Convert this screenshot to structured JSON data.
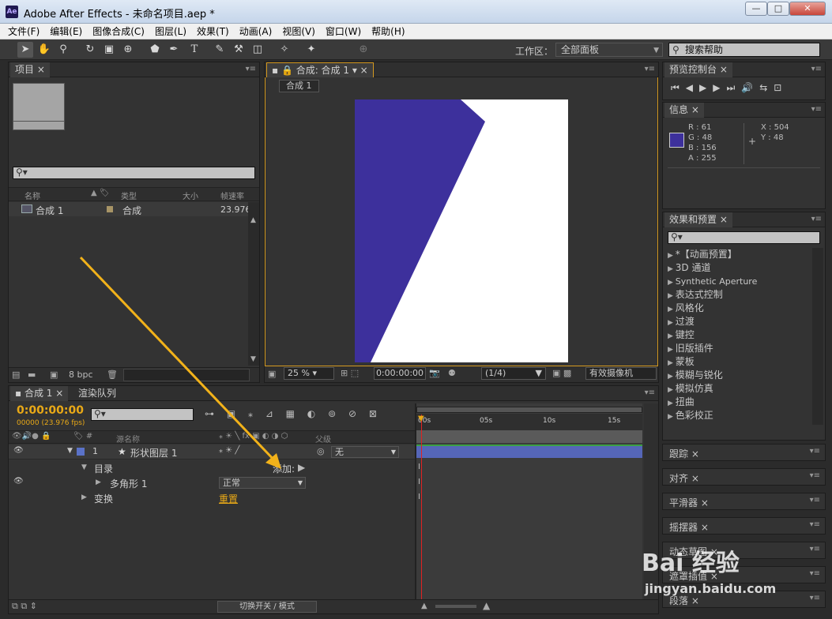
{
  "window": {
    "title": "Adobe After Effects - 未命名项目.aep *",
    "logo": "Ae",
    "minimize": "—",
    "maximize": "□",
    "close": "✕"
  },
  "menu": [
    "文件(F)",
    "编辑(E)",
    "图像合成(C)",
    "图层(L)",
    "效果(T)",
    "动画(A)",
    "视图(V)",
    "窗口(W)",
    "帮助(H)"
  ],
  "toolbar": {
    "workspace_label": "工作区：",
    "workspace_value": "全部面板",
    "search_placeholder": "搜索帮助"
  },
  "project": {
    "tab": "项目",
    "cols": [
      "名称",
      "类型",
      "大小",
      "帧速率"
    ],
    "item_name": "合成 1",
    "item_type": "合成",
    "item_fps": "23.976",
    "bpc": "8 bpc"
  },
  "comp": {
    "tab": "合成: 合成 1",
    "breadcrumb": "合成 1",
    "zoom": "25 %",
    "timecode": "0:00:00:00",
    "resolution": "(1/4)",
    "camera": "有效摄像机"
  },
  "preview": {
    "tab": "预览控制台"
  },
  "info": {
    "tab": "信息",
    "r": "R : 61",
    "g": "G : 48",
    "b": "B : 156",
    "a": "A : 255",
    "x": "X : 504",
    "y": "Y : 48",
    "swatch": "#3d309c"
  },
  "effects": {
    "tab": "效果和预置",
    "items": [
      "*【动画预置】",
      "3D 通道",
      "Synthetic Aperture",
      "表达式控制",
      "风格化",
      "过渡",
      "键控",
      "旧版插件",
      "蒙板",
      "模糊与锐化",
      "模拟仿真",
      "扭曲",
      "色彩校正"
    ]
  },
  "side_panels": [
    "跟踪",
    "对齐",
    "平滑器",
    "摇摆器",
    "动态草图",
    "遮罩插值",
    "段落"
  ],
  "timeline": {
    "tab": "合成 1",
    "render_tab": "渲染队列",
    "timecode": "0:00:00:00",
    "fps": "00000 (23.976 fps)",
    "source_col": "源名称",
    "parent_col": "父级",
    "layer_num": "1",
    "layer_name": "形状图层 1",
    "parent_value": "无",
    "contents": "目录",
    "add": "添加:",
    "polygon": "多角形 1",
    "blend": "正常",
    "transform": "变换",
    "reset": "重置",
    "ruler": [
      "00s",
      "05s",
      "10s",
      "15s"
    ],
    "footer": "切换开关 / 模式"
  },
  "watermark": "Bai 经验",
  "watermark_url": "jingyan.baidu.com"
}
